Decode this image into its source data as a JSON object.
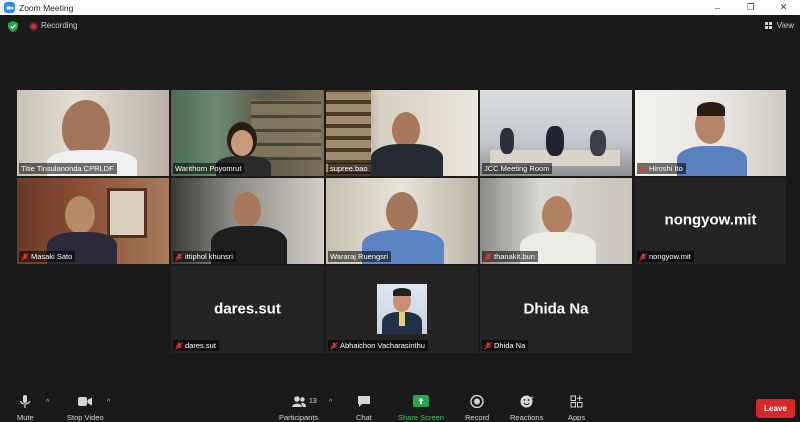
{
  "window": {
    "title": "Zoom Meeting"
  },
  "status": {
    "recording_label": "Recording",
    "view_label": "View"
  },
  "participants": [
    {
      "name": "Titie Tinsulanonda CPRLDF",
      "muted": false,
      "active": false
    },
    {
      "name": "Warithorn Poyomrut",
      "muted": false,
      "active": true
    },
    {
      "name": "supree.bao",
      "muted": false,
      "active": false
    },
    {
      "name": "JCC Meeting Room",
      "muted": false,
      "active": false
    },
    {
      "name": "Hiroshi Ito",
      "muted": true,
      "active": false
    },
    {
      "name": "Masaki Sato",
      "muted": true,
      "active": false
    },
    {
      "name": "ittiphol khunsri",
      "muted": true,
      "active": false
    },
    {
      "name": "Wararaj Ruengsri",
      "muted": false,
      "active": false
    },
    {
      "name": "thanakit.bun",
      "muted": true,
      "active": false
    },
    {
      "name": "nongyow.mit",
      "muted": true,
      "active": false,
      "display_name": "nongyow.mit"
    },
    {
      "name": "dares.sut",
      "muted": true,
      "active": false,
      "display_name": "dares.sut"
    },
    {
      "name": "Abhaichon Vacharasinthu",
      "muted": true,
      "active": false
    },
    {
      "name": "Dhida Na",
      "muted": true,
      "active": false,
      "display_name": "Dhida Na"
    }
  ],
  "toolbar": {
    "mute_label": "Mute",
    "video_label": "Stop Video",
    "participants_label": "Participants",
    "participants_count": "13",
    "chat_label": "Chat",
    "share_label": "Share Screen",
    "record_label": "Record",
    "reactions_label": "Reactions",
    "apps_label": "Apps",
    "leave_label": "Leave"
  },
  "colors": {
    "active_speaker": "#c8e33a",
    "leave": "#d62a2a",
    "share": "#23a74a"
  }
}
